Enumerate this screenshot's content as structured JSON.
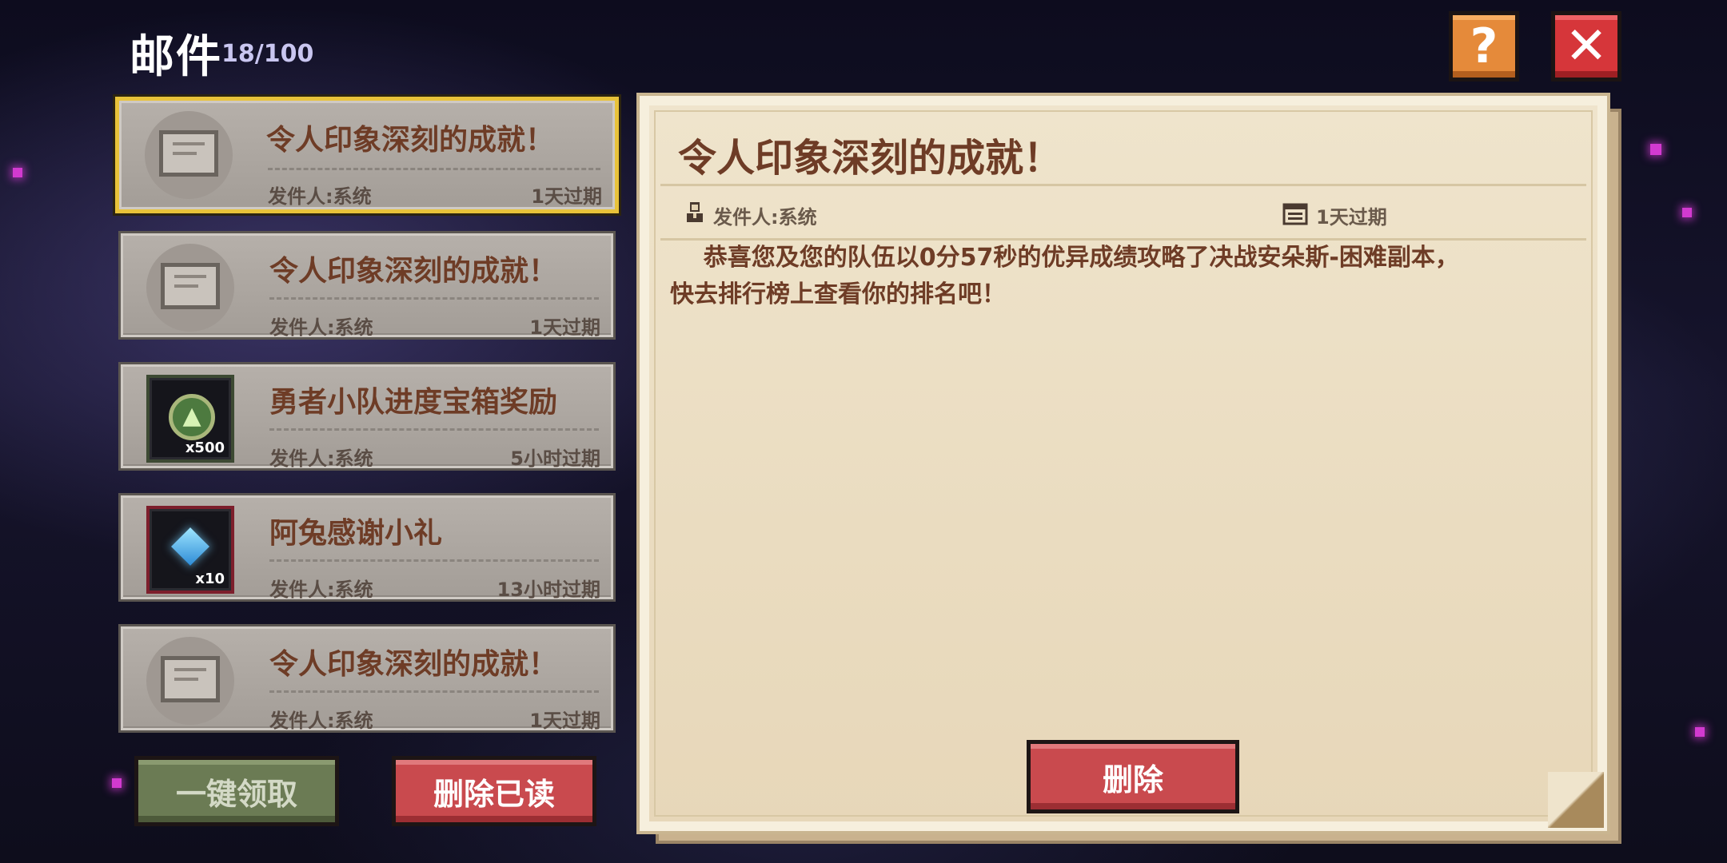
{
  "header": {
    "title": "邮件",
    "count": "18/100",
    "help_icon_glyph": "?",
    "close_icon_glyph": "✕"
  },
  "mail_list": [
    {
      "title": "令人印象深刻的成就！",
      "sender": "发件人:系统",
      "expire": "1天过期",
      "thumb": "envelope-icon",
      "selected": true
    },
    {
      "title": "令人印象深刻的成就！",
      "sender": "发件人:系统",
      "expire": "1天过期",
      "thumb": "envelope-icon",
      "selected": false
    },
    {
      "title": "勇者小队进度宝箱奖励",
      "sender": "发件人:系统",
      "expire": "5小时过期",
      "thumb": "upgrade-coin-icon",
      "qty": "x500",
      "selected": false
    },
    {
      "title": "阿兔感谢小礼",
      "sender": "发件人:系统",
      "expire": "13小时过期",
      "thumb": "diamond-gem-icon",
      "qty": "x10",
      "selected": false
    },
    {
      "title": "令人印象深刻的成就！",
      "sender": "发件人:系统",
      "expire": "1天过期",
      "thumb": "envelope-icon",
      "selected": false
    }
  ],
  "buttons": {
    "claim_all": "一键领取",
    "delete_read": "删除已读",
    "delete": "删除"
  },
  "letter": {
    "title": "令人印象深刻的成就！",
    "sender": "发件人:系统",
    "expire": "1天过期",
    "body": "    恭喜您及您的队伍以0分57秒的优异成绩攻略了决战安朵斯-困难副本，\n快去排行榜上查看你的排名吧！"
  },
  "colors": {
    "accent_selected": "#e8c23a",
    "title_brown": "#6e3c26",
    "help_orange": "#e58a3a",
    "close_red": "#d6363a",
    "claim_green": "#6b7b54",
    "delete_red": "#c94a4e"
  }
}
